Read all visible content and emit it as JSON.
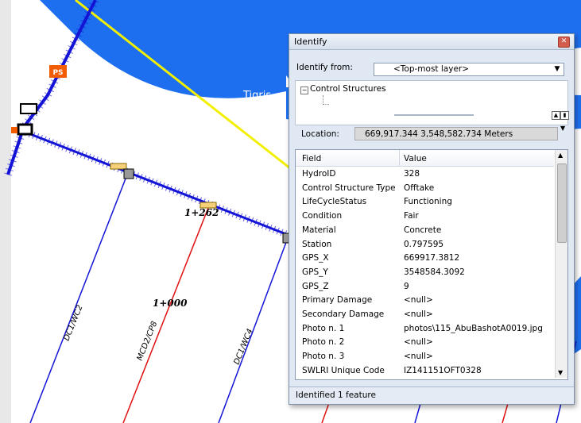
{
  "map": {
    "river_label": "Tigris",
    "pump_station_label": "PS",
    "station_labels": [
      "1+262",
      "1+000"
    ],
    "canal_labels": [
      "DC1/WC2",
      "MCD2/CP8",
      "DC1/WC4"
    ],
    "colors": {
      "river": "#1e6ff0",
      "boundary": "#f2f000",
      "canal": "#1414d6",
      "drain": "#e01010",
      "pump_station": "#f25c05"
    }
  },
  "window": {
    "title": "Identify",
    "close_icon": "close-icon",
    "identify_from_label": "Identify from:",
    "identify_from_value": "<Top-most layer>",
    "tree_root": "Control Structures",
    "location_label": "Location:",
    "location_value": "669,917.344  3,548,582.734 Meters",
    "columns": {
      "field": "Field",
      "value": "Value"
    },
    "rows": [
      {
        "field": "HydroID",
        "value": "328"
      },
      {
        "field": "Control Structure Type",
        "value": "Offtake"
      },
      {
        "field": "LifeCycleStatus",
        "value": "Functioning"
      },
      {
        "field": "Condition",
        "value": "Fair"
      },
      {
        "field": "Material",
        "value": "Concrete"
      },
      {
        "field": "Station",
        "value": "0.797595"
      },
      {
        "field": "GPS_X",
        "value": "669917.3812"
      },
      {
        "field": "GPS_Y",
        "value": "3548584.3092"
      },
      {
        "field": "GPS_Z",
        "value": "9"
      },
      {
        "field": "Primary Damage",
        "value": "<null>"
      },
      {
        "field": "Secondary Damage",
        "value": "<null>"
      },
      {
        "field": "Photo n. 1",
        "value": "photos\\115_AbuBashotA0019.jpg"
      },
      {
        "field": "Photo n. 2",
        "value": "<null>"
      },
      {
        "field": "Photo n. 3",
        "value": "<null>"
      },
      {
        "field": "SWLRI Unique Code",
        "value": "IZ141151OFT0328"
      }
    ],
    "status": "Identified 1 feature"
  }
}
